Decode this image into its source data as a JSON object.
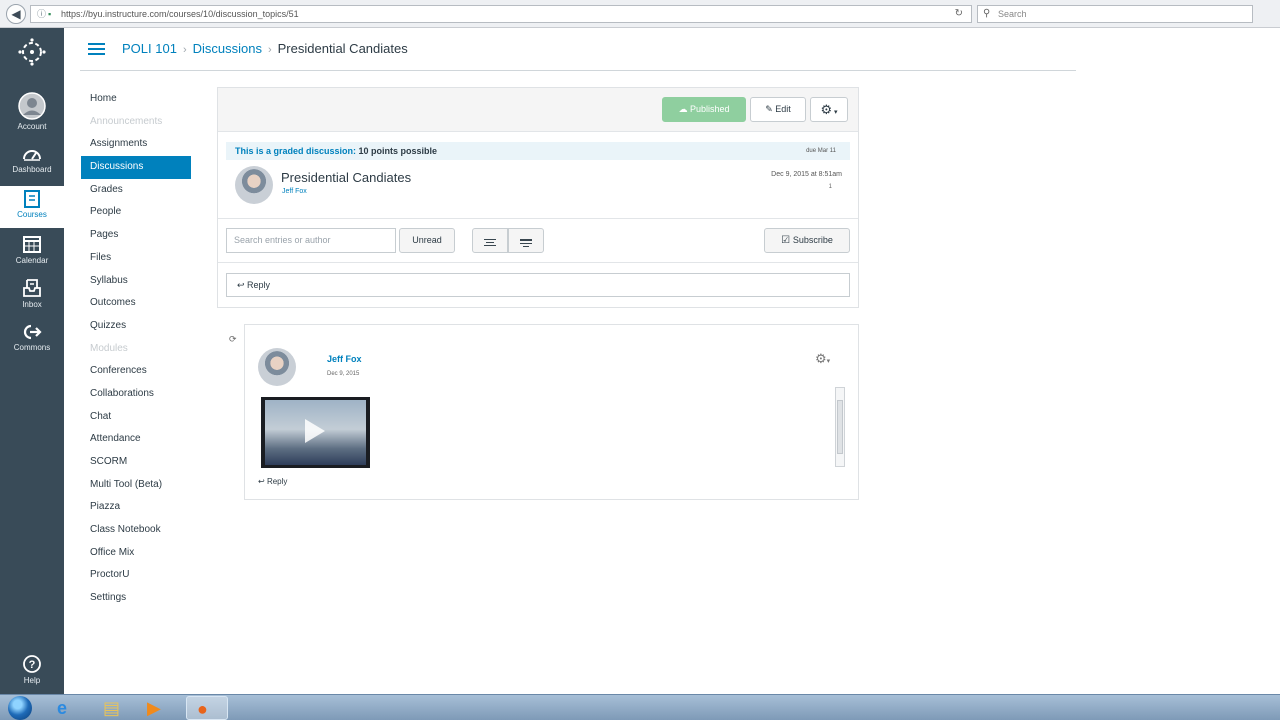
{
  "browser": {
    "url": "https://byu.instructure.com/courses/10/discussion_topics/51",
    "search_placeholder": "Search"
  },
  "global_nav": {
    "items": [
      {
        "label": "Account",
        "icon": "account-icon"
      },
      {
        "label": "Dashboard",
        "icon": "dashboard-icon"
      },
      {
        "label": "Courses",
        "icon": "courses-icon",
        "active": true
      },
      {
        "label": "Calendar",
        "icon": "calendar-icon"
      },
      {
        "label": "Inbox",
        "icon": "inbox-icon"
      },
      {
        "label": "Commons",
        "icon": "commons-icon"
      }
    ],
    "help_label": "Help"
  },
  "header": {
    "breadcrumbs": [
      "POLI 101",
      "Discussions",
      "Presidential Candiates"
    ]
  },
  "course_nav": {
    "items": [
      {
        "label": "Home"
      },
      {
        "label": "Announcements",
        "disabled": true
      },
      {
        "label": "Assignments"
      },
      {
        "label": "Discussions",
        "active": true
      },
      {
        "label": "Grades"
      },
      {
        "label": "People"
      },
      {
        "label": "Pages"
      },
      {
        "label": "Files"
      },
      {
        "label": "Syllabus"
      },
      {
        "label": "Outcomes"
      },
      {
        "label": "Quizzes"
      },
      {
        "label": "Modules",
        "disabled": true
      },
      {
        "label": "Conferences"
      },
      {
        "label": "Collaborations"
      },
      {
        "label": "Chat"
      },
      {
        "label": "Attendance"
      },
      {
        "label": "SCORM"
      },
      {
        "label": "Multi Tool (Beta)"
      },
      {
        "label": "Piazza"
      },
      {
        "label": "Class Notebook"
      },
      {
        "label": "Office Mix"
      },
      {
        "label": "ProctorU"
      },
      {
        "label": "Settings"
      }
    ]
  },
  "toolbar": {
    "published_label": "Published",
    "edit_label": "Edit"
  },
  "topic": {
    "graded_prefix": "This is a graded discussion:",
    "points": "10 points possible",
    "due": "due Mar 11",
    "title": "Presidential Candiates",
    "author": "Jeff Fox",
    "date": "Dec 9, 2015 at 8:51am",
    "count": "1"
  },
  "filters": {
    "search_placeholder": "Search entries or author",
    "unread_label": "Unread",
    "subscribe_label": "Subscribe"
  },
  "reply_label": "Reply",
  "entry": {
    "author": "Jeff Fox",
    "date": "Dec 9, 2015",
    "reply_label": "Reply"
  },
  "colors": {
    "accent": "#0081bd",
    "global_nav_bg": "#394b58",
    "published_green": "#8fcf9f"
  }
}
